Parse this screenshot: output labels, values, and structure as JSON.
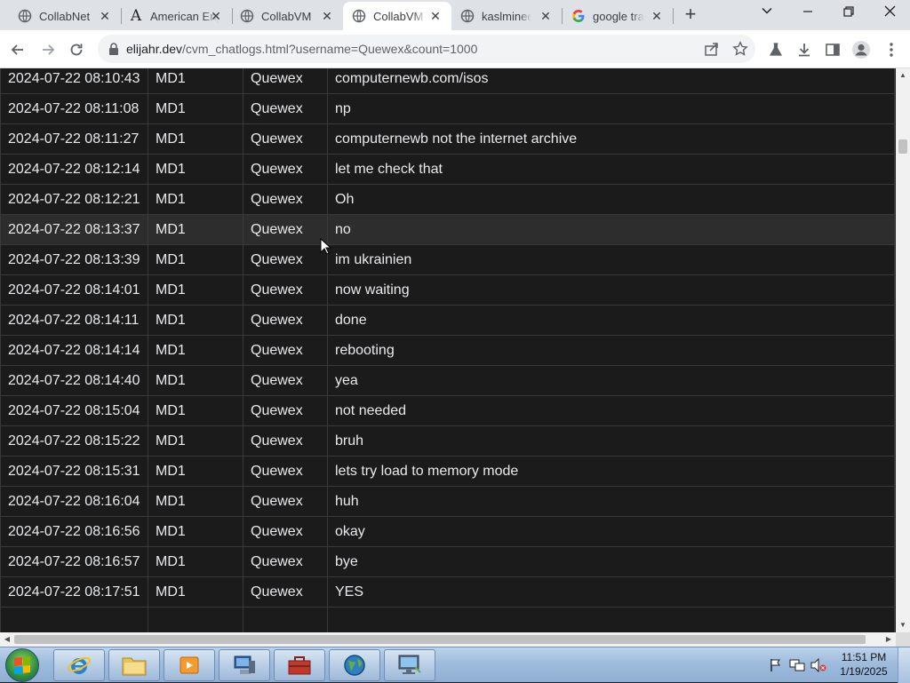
{
  "tabs": [
    {
      "title": "CollabNet",
      "icon": "globe-icon",
      "active": false
    },
    {
      "title": "American English",
      "icon": "font-a-icon",
      "active": false
    },
    {
      "title": "CollabVM",
      "icon": "globe-icon",
      "active": false
    },
    {
      "title": "CollabVM",
      "icon": "globe-icon",
      "active": true
    },
    {
      "title": "kaslmineer",
      "icon": "globe-icon",
      "active": false
    },
    {
      "title": "google translate",
      "icon": "google-icon",
      "active": false
    }
  ],
  "address_bar": {
    "host": "elijahr.dev",
    "path": "/cvm_chatlogs.html?username=Quewex&count=1000"
  },
  "chatlog": {
    "rows": [
      {
        "time": "2024-07-22 08:10:43",
        "vm": "MD1",
        "user": "Quewex",
        "message": "computernewb.com/isos"
      },
      {
        "time": "2024-07-22 08:11:08",
        "vm": "MD1",
        "user": "Quewex",
        "message": "np"
      },
      {
        "time": "2024-07-22 08:11:27",
        "vm": "MD1",
        "user": "Quewex",
        "message": "computernewb not the internet archive"
      },
      {
        "time": "2024-07-22 08:12:14",
        "vm": "MD1",
        "user": "Quewex",
        "message": "let me check that"
      },
      {
        "time": "2024-07-22 08:12:21",
        "vm": "MD1",
        "user": "Quewex",
        "message": "Oh"
      },
      {
        "time": "2024-07-22 08:13:37",
        "vm": "MD1",
        "user": "Quewex",
        "message": "no"
      },
      {
        "time": "2024-07-22 08:13:39",
        "vm": "MD1",
        "user": "Quewex",
        "message": "im ukrainien"
      },
      {
        "time": "2024-07-22 08:14:01",
        "vm": "MD1",
        "user": "Quewex",
        "message": "now waiting"
      },
      {
        "time": "2024-07-22 08:14:11",
        "vm": "MD1",
        "user": "Quewex",
        "message": "done"
      },
      {
        "time": "2024-07-22 08:14:14",
        "vm": "MD1",
        "user": "Quewex",
        "message": "rebooting"
      },
      {
        "time": "2024-07-22 08:14:40",
        "vm": "MD1",
        "user": "Quewex",
        "message": "yea"
      },
      {
        "time": "2024-07-22 08:15:04",
        "vm": "MD1",
        "user": "Quewex",
        "message": "not needed"
      },
      {
        "time": "2024-07-22 08:15:22",
        "vm": "MD1",
        "user": "Quewex",
        "message": "bruh"
      },
      {
        "time": "2024-07-22 08:15:31",
        "vm": "MD1",
        "user": "Quewex",
        "message": "lets try load to memory mode"
      },
      {
        "time": "2024-07-22 08:16:04",
        "vm": "MD1",
        "user": "Quewex",
        "message": "huh"
      },
      {
        "time": "2024-07-22 08:16:56",
        "vm": "MD1",
        "user": "Quewex",
        "message": "okay"
      },
      {
        "time": "2024-07-22 08:16:57",
        "vm": "MD1",
        "user": "Quewex",
        "message": "bye"
      },
      {
        "time": "2024-07-22 08:17:51",
        "vm": "MD1",
        "user": "Quewex",
        "message": "YES"
      },
      {
        "time": "",
        "vm": "",
        "user": "",
        "message": ""
      }
    ]
  },
  "taskbar": {
    "apps": [
      {
        "name": "internet-explorer-icon"
      },
      {
        "name": "file-explorer-icon"
      },
      {
        "name": "media-player-icon"
      },
      {
        "name": "network-computer-icon"
      },
      {
        "name": "toolbox-icon"
      },
      {
        "name": "globe-browser-icon"
      },
      {
        "name": "remote-desktop-icon"
      }
    ],
    "clock": {
      "time": "11:51 PM",
      "date": "1/19/2025"
    }
  },
  "colors": {
    "page_bg": "#202124",
    "row_bg": "#1b1b1b",
    "row_hover_bg": "#2d2d2d",
    "text": "#e8eaed",
    "border": "#3a3a3a"
  }
}
